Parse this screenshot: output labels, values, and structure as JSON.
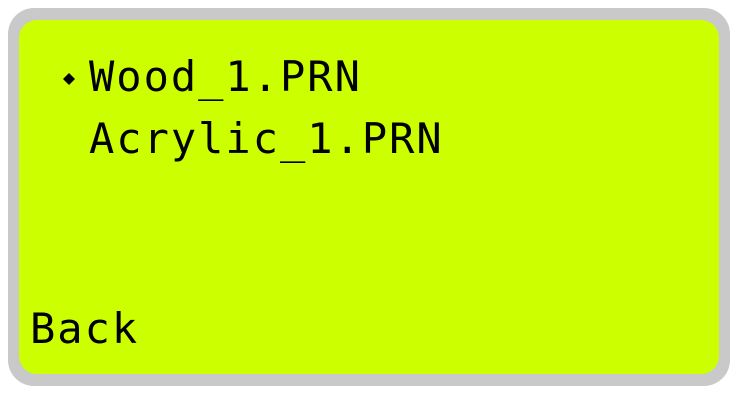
{
  "menu": {
    "cursor_icon": "diamond-selector-icon",
    "items": [
      {
        "label": "Wood_1.PRN",
        "selected": true
      },
      {
        "label": "Acrylic_1.PRN",
        "selected": false
      }
    ],
    "back_label": "Back"
  },
  "colors": {
    "screen_background": "#ccff00",
    "bezel": "#c9c9c9",
    "text": "#000000"
  }
}
